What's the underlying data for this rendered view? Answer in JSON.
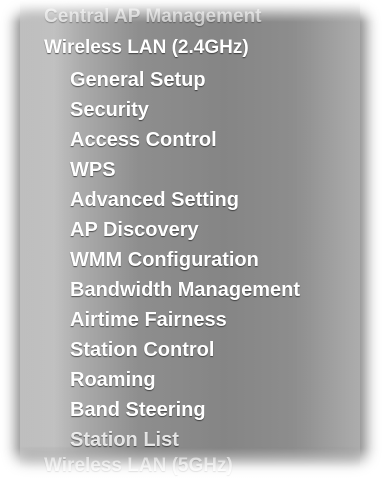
{
  "menu": {
    "prev_section_label": "Central AP Management",
    "active_section_label": "Wireless LAN (2.4GHz)",
    "items": [
      {
        "label": "General Setup"
      },
      {
        "label": "Security"
      },
      {
        "label": "Access Control"
      },
      {
        "label": "WPS"
      },
      {
        "label": "Advanced Setting"
      },
      {
        "label": "AP Discovery"
      },
      {
        "label": "WMM Configuration"
      },
      {
        "label": "Bandwidth Management"
      },
      {
        "label": "Airtime Fairness"
      },
      {
        "label": "Station Control"
      },
      {
        "label": "Roaming"
      },
      {
        "label": "Band Steering"
      },
      {
        "label": "Station List"
      }
    ],
    "next_section_label": "Wireless LAN (5GHz)"
  }
}
